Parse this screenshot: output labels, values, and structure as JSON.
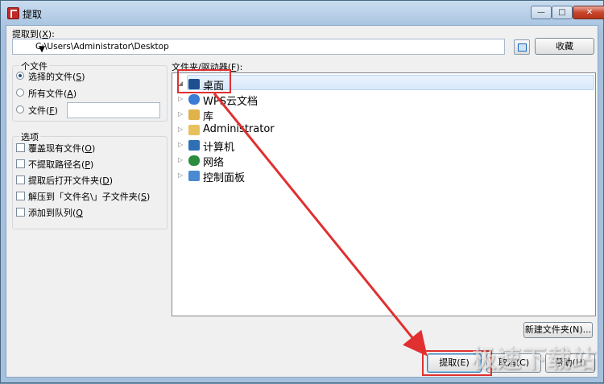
{
  "window": {
    "title": "提取",
    "minimize": "—",
    "maximize": "□",
    "close": "✕"
  },
  "target": {
    "label": "提取到(",
    "hotkey": "X",
    "label_end": "):",
    "path": "C:\\Users\\Administrator\\Desktop",
    "dropdown": "▼",
    "favorites_button": "收藏"
  },
  "files_group": {
    "title": "个文件",
    "options": [
      {
        "text": "选择的文件(",
        "hotkey": "S",
        "end": ")",
        "selected": true
      },
      {
        "text": "所有文件(",
        "hotkey": "A",
        "end": ")",
        "selected": false
      },
      {
        "text": "文件(",
        "hotkey": "F",
        "end": ")",
        "selected": false
      }
    ],
    "file_value": ""
  },
  "options_group": {
    "title": "选项",
    "items": [
      {
        "text": "覆盖现有文件(",
        "hotkey": "O",
        "end": ")"
      },
      {
        "text": "不提取路径名(",
        "hotkey": "P",
        "end": ")"
      },
      {
        "text": "提取后打开文件夹(",
        "hotkey": "D",
        "end": ")"
      },
      {
        "text": "解压到「文件名\\」子文件夹(",
        "hotkey": "S",
        "end": ")"
      },
      {
        "text": "添加到队列(",
        "hotkey": "Q",
        "end": ""
      }
    ]
  },
  "tree": {
    "label": "文件夹/驱动器(",
    "hotkey": "F",
    "label_end": "):",
    "items": [
      {
        "label": "桌面",
        "icon": "desktop-icon",
        "expander": "◢",
        "color": "#1d4f91"
      },
      {
        "label": "WPS云文档",
        "icon": "cloud-icon",
        "expander": "▷",
        "color": "#3a7bd5"
      },
      {
        "label": "库",
        "icon": "library-icon",
        "expander": "▷",
        "color": "#e0b24a"
      },
      {
        "label": "Administrator",
        "icon": "user-folder-icon",
        "expander": "▷",
        "color": "#e8c15c"
      },
      {
        "label": "计算机",
        "icon": "computer-icon",
        "expander": "▷",
        "color": "#2f6fb5"
      },
      {
        "label": "网络",
        "icon": "network-icon",
        "expander": "▷",
        "color": "#2a8c3c"
      },
      {
        "label": "控制面板",
        "icon": "control-panel-icon",
        "expander": "▷",
        "color": "#4a8ad0"
      }
    ]
  },
  "buttons": {
    "new_folder": "新建文件夹(N)...",
    "extract": "提取(E)",
    "cancel": "取消(C)",
    "help": "帮助(H)"
  },
  "watermark": "极速下载站",
  "colors": {
    "annotation": "#e03030",
    "selection": "#d7e8fb"
  }
}
